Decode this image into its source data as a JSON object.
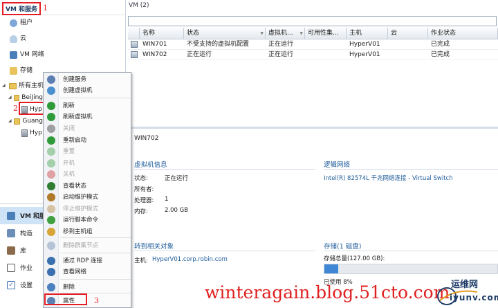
{
  "left_nav": {
    "title": "VM 和服务",
    "items": [
      "租户",
      "云",
      "VM 网络",
      "存储",
      "所有主机"
    ],
    "tree": [
      "BeiJing",
      "Hyp",
      "Guang",
      "Hyp"
    ],
    "workspaces": [
      "VM 和服务",
      "构造",
      "库",
      "作业",
      "设置"
    ]
  },
  "annotations": {
    "one": "1",
    "two": "2",
    "three": "3"
  },
  "main": {
    "vm_count": "VM (2)",
    "columns": [
      "名称",
      "状态",
      "虚拟机...",
      "可用性集...",
      "主机",
      "云",
      "作业状态"
    ],
    "rows": [
      {
        "name": "WIN701",
        "status": "不受支持的虚拟机配置",
        "vm_status": "正在运行",
        "availability": "",
        "host": "HyperV01",
        "cloud": "",
        "job": "已完成"
      },
      {
        "name": "WIN702",
        "status": "正在运行",
        "vm_status": "正在运行",
        "availability": "",
        "host": "HyperV01",
        "cloud": "",
        "job": "已完成"
      }
    ]
  },
  "detail": {
    "title": "WIN702",
    "vm_info": {
      "heading": "虚拟机信息",
      "status_label": "状态:",
      "status_value": "正在运行",
      "owner_label": "所有者:",
      "cpu_label": "处理器:",
      "cpu_value": "1",
      "mem_label": "内存:",
      "mem_value": "2.00 GB"
    },
    "network": {
      "heading": "逻辑网络",
      "adapter": "Intel(R) 82574L 千兆网络连接 - Virtual Switch"
    },
    "related": {
      "heading": "转到相关对象",
      "host_label": "主机:",
      "host_value": "HyperV01.corp.robin.com"
    },
    "storage": {
      "heading": "存储(1 磁盘)",
      "total": "存储总量(127.00 GB):",
      "used": "已使用 8%",
      "used_fraction": 0.08
    }
  },
  "context_menu": {
    "items": [
      {
        "label": "创建服务",
        "enabled": true,
        "color": "#5b7fb3"
      },
      {
        "label": "创建虚拟机",
        "enabled": true,
        "color": "#4a8fcf"
      },
      {
        "label": "刷新",
        "enabled": true,
        "color": "#2f9a3a"
      },
      {
        "label": "刷新虚拟机",
        "enabled": true,
        "color": "#2f9a3a"
      },
      {
        "label": "关闭",
        "enabled": false,
        "color": "#222222"
      },
      {
        "label": "重新启动",
        "enabled": true,
        "color": "#2f9a3a"
      },
      {
        "label": "重置",
        "enabled": false,
        "color": "#2f9a3a"
      },
      {
        "label": "开机",
        "enabled": false,
        "color": "#2f9a3a"
      },
      {
        "label": "关机",
        "enabled": false,
        "color": "#c62828"
      },
      {
        "label": "查看状态",
        "enabled": true,
        "color": "#2e7d32"
      },
      {
        "label": "启动维护模式",
        "enabled": true,
        "color": "#b07a2a"
      },
      {
        "label": "停止维护模式",
        "enabled": false,
        "color": "#b07a2a"
      },
      {
        "label": "运行脚本命令",
        "enabled": true,
        "color": "#3f9f3f"
      },
      {
        "label": "移到主机组",
        "enabled": true,
        "color": "#d9a437"
      },
      {
        "label": "删除群集节点",
        "enabled": false,
        "color": "#5a7da6"
      },
      {
        "label": "通过 RDP 连接",
        "enabled": true,
        "color": "#3a6fb0"
      },
      {
        "label": "查看网络",
        "enabled": true,
        "color": "#3a6fb0"
      },
      {
        "label": "删除",
        "enabled": true,
        "color": "#4a7fc0"
      },
      {
        "label": "属性",
        "enabled": true,
        "color": "#5b7fb3"
      }
    ]
  },
  "watermark": "winteragain.blog.51cto.com",
  "logo": {
    "line1": "运维网",
    "line2": "iyunv.com"
  },
  "colors": {
    "annotation_red": "#e51c23",
    "link_blue": "#1c5b9a",
    "selection": "#cfe3f7"
  }
}
